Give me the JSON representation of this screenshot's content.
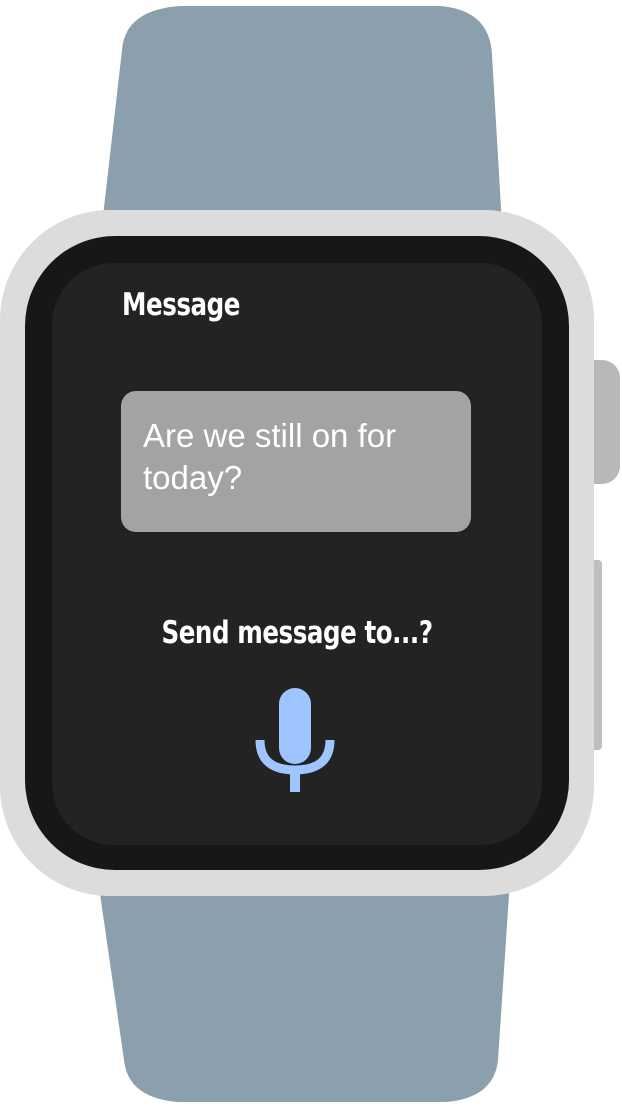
{
  "app": {
    "title": "Message"
  },
  "message": {
    "text": "Are we still on for today?"
  },
  "prompt": {
    "text": "Send message to...?"
  },
  "mic": {
    "icon": "microphone-icon",
    "color": "#9ec5ff"
  },
  "colors": {
    "band": "#8c9fac",
    "case": "#dcdcdc",
    "bezel": "#171717",
    "screen": "#232323",
    "bubble": "#a3a3a3",
    "crown": "#b9b8b9",
    "side_button": "#bfbfbf",
    "accent": "#9ec5ff"
  }
}
